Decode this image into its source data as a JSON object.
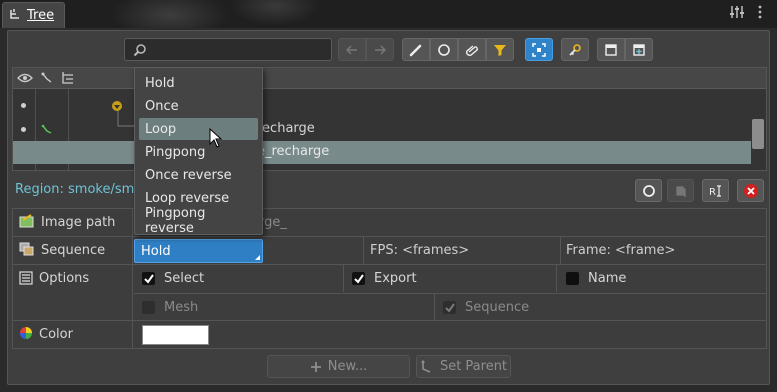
{
  "tab": {
    "title": "Tree"
  },
  "search": {
    "placeholder": ""
  },
  "tree": {
    "rows": [
      {
        "text": ""
      },
      {
        "text": "recharge"
      },
      {
        "text": "e_recharge"
      }
    ]
  },
  "region": {
    "label": "Region: smoke/smo"
  },
  "properties": {
    "image_path": {
      "label": "Image path",
      "value": "rge_"
    },
    "sequence": {
      "label": "Sequence",
      "selected": "Hold",
      "fps": "FPS: <frames>",
      "frame": "Frame: <frame>"
    },
    "options": {
      "label": "Options",
      "select": "Select",
      "export": "Export",
      "name": "Name",
      "mesh": "Mesh",
      "sequence": "Sequence"
    },
    "color": {
      "label": "Color",
      "value": "#ffffff"
    }
  },
  "buttons": {
    "new": "New...",
    "set_parent": "Set Parent"
  },
  "dropdown": {
    "options": [
      "Hold",
      "Once",
      "Loop",
      "Pingpong",
      "Once reverse",
      "Loop reverse",
      "Pingpong reverse"
    ],
    "hovered": "Loop"
  },
  "colors": {
    "accent": "#2f7fc5",
    "region_text": "#6ec3d5",
    "selected_row": "#788a8a"
  }
}
